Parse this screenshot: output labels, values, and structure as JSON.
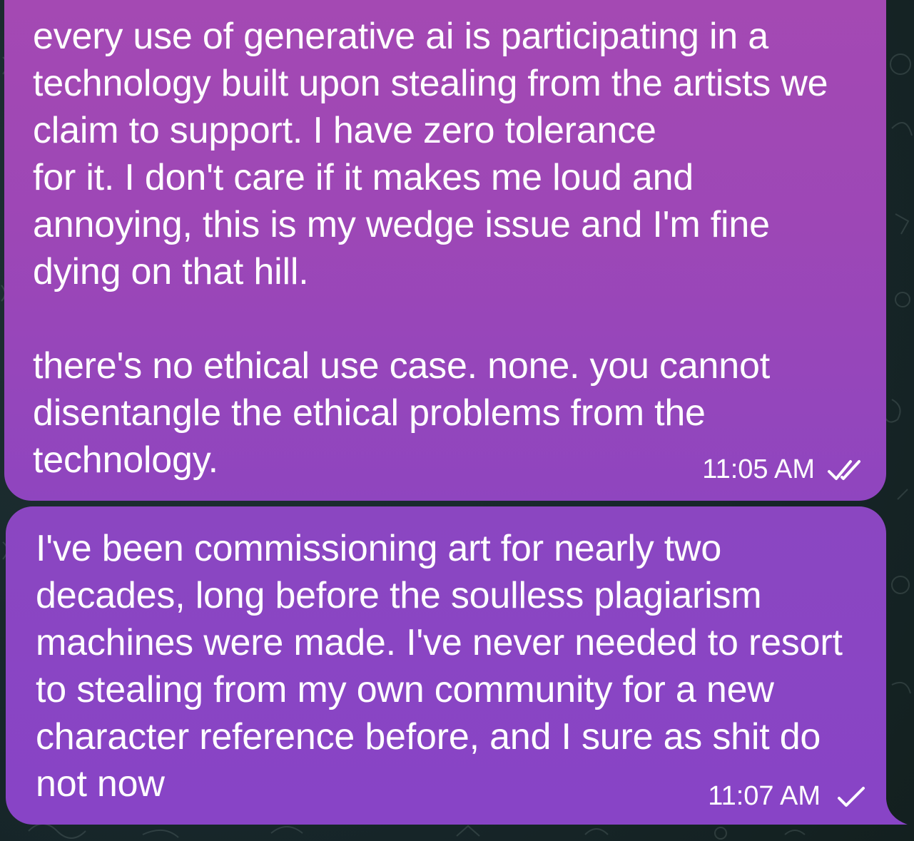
{
  "messages": [
    {
      "text": "every use of generative ai is participating in a technology built upon stealing from the artists we claim to support. I have zero tolerance\nfor it. I don't care if it makes me loud and annoying, this is my wedge issue and I'm fine dying on that hill.\n\nthere's no ethical use case. none. you cannot disentangle the ethical problems from the technology.",
      "time": "11:05 AM",
      "status_icon": "double-check-icon"
    },
    {
      "text": "I've been commissioning art for nearly two decades, long before the soulless plagiarism machines were made. I've never needed to resort to stealing from my own community for a new character reference before, and I sure as shit do not now",
      "time": "11:07 AM",
      "status_icon": "single-check-icon"
    }
  ],
  "colors": {
    "bubble_top": "#a449b3",
    "bubble_bottom": "#8844c6",
    "background": "#1b2a2c",
    "text": "#ffffff"
  }
}
